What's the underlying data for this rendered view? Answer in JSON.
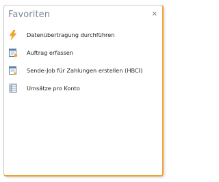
{
  "panel": {
    "title": "Favoriten",
    "close_glyph": "×"
  },
  "items": [
    {
      "label": "Datenübertragung durchführen",
      "icon": "lightning-icon"
    },
    {
      "label": "Auftrag erfassen",
      "icon": "order-document-icon"
    },
    {
      "label": "Sende-Job für Zahlungen erstellen (HBCI)",
      "icon": "send-job-document-icon"
    },
    {
      "label": "Umsätze pro Konto",
      "icon": "table-list-icon"
    }
  ],
  "colors": {
    "accent_border": "#f0a030",
    "title": "#7a8a9a",
    "lightning": "#f5a623"
  }
}
